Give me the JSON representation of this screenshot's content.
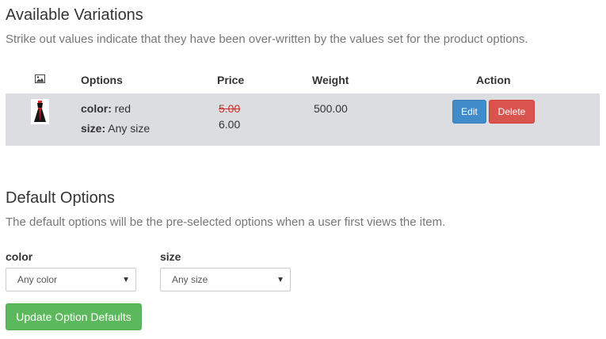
{
  "variations": {
    "title": "Available Variations",
    "description": "Strike out values indicate that they have been over-written by the values set for the product options.",
    "headers": {
      "image": "image-icon",
      "options": "Options",
      "price": "Price",
      "weight": "Weight",
      "action": "Action"
    },
    "rows": [
      {
        "image": "dress-thumbnail",
        "options": [
          {
            "key": "color:",
            "value": "red"
          },
          {
            "key": "size:",
            "value": "Any size"
          }
        ],
        "price_original": "5.00",
        "price_current": "6.00",
        "weight": "500.00",
        "edit_label": "Edit",
        "delete_label": "Delete"
      }
    ]
  },
  "defaults": {
    "title": "Default Options",
    "description": "The default options will be the pre-selected options when a user first views the item.",
    "fields": [
      {
        "label": "color",
        "selected": "Any color"
      },
      {
        "label": "size",
        "selected": "Any size"
      }
    ],
    "submit_label": "Update Option Defaults"
  },
  "colors": {
    "row_bg": "#dcdde1",
    "edit": "#428bca",
    "delete": "#d9534f",
    "update": "#5cb85c",
    "strike": "#c9302c"
  }
}
